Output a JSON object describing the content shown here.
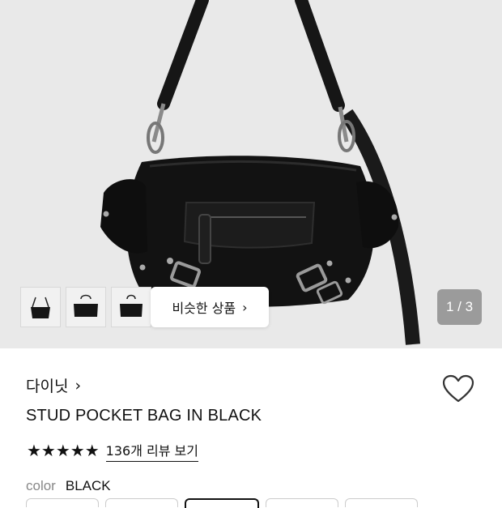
{
  "gallery": {
    "similar_button_label": "비슷한 상품",
    "similar_button_chevron": "›",
    "counter": "1 / 3",
    "thumbnails": [
      "thumb-1",
      "thumb-2",
      "thumb-3"
    ]
  },
  "product": {
    "brand": "다이닛",
    "brand_chevron": "›",
    "title": "STUD POCKET BAG IN BLACK",
    "stars": "★★★★★",
    "review_link": "136개 리뷰 보기",
    "color_label": "color",
    "color_value": "BLACK"
  },
  "colors": {
    "background_hero": "#e9e9e9",
    "accent": "#111111"
  }
}
